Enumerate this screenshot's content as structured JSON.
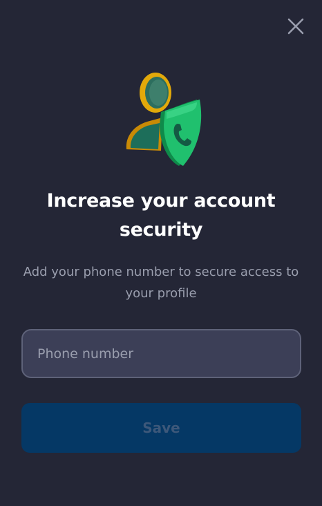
{
  "dialog": {
    "close_icon": "close-icon",
    "illustration_icon": "user-shield-phone-icon",
    "title": "Increase your account security",
    "subtitle": "Add your phone number to secure access to your profile",
    "phone_input": {
      "value": "",
      "placeholder": "Phone number"
    },
    "save_label": "Save"
  },
  "colors": {
    "background": "#242636",
    "input_background": "#3c3f57",
    "input_border": "#5e6279",
    "save_button_background": "#053865",
    "save_button_text": "#3d587a",
    "title": "#ffffff",
    "subtitle": "#9a9eae",
    "close_icon": "#9a9eae",
    "shield_green": "#1fc16b",
    "avatar_gold": "#f2b705"
  }
}
